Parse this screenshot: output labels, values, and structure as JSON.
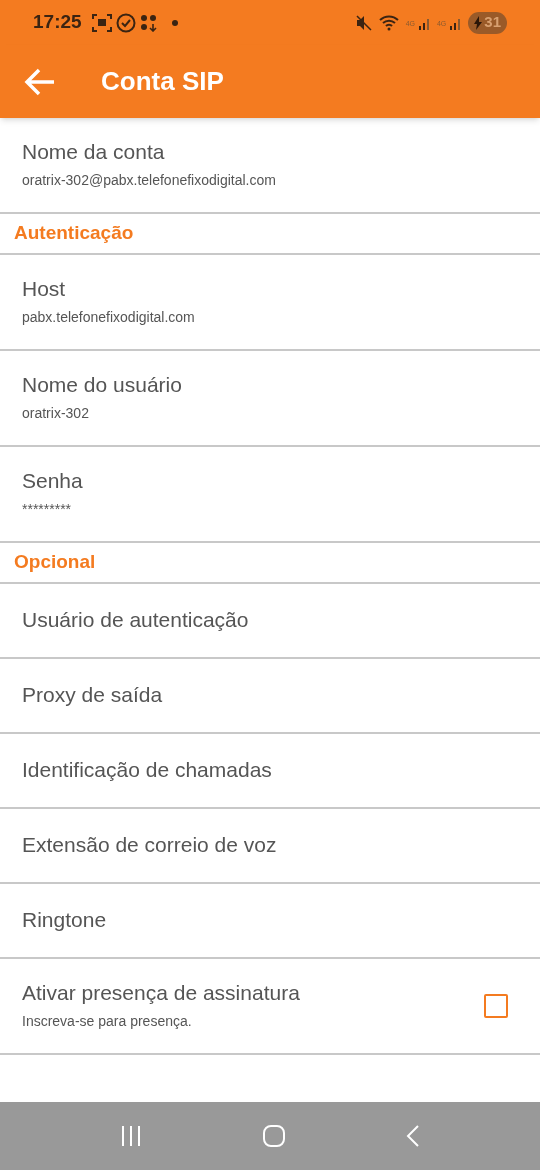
{
  "status_bar": {
    "time": "17:25",
    "network_labels": [
      "4G",
      "4G"
    ],
    "battery": "31"
  },
  "header": {
    "title": "Conta SIP"
  },
  "rows": [
    {
      "kind": "item",
      "title": "Nome da conta",
      "subtitle": "oratrix-302@pabx.telefonefixodigital.com"
    },
    {
      "kind": "section",
      "title": "Autenticação"
    },
    {
      "kind": "item",
      "title": "Host",
      "subtitle": "pabx.telefonefixodigital.com"
    },
    {
      "kind": "item",
      "title": "Nome do usuário",
      "subtitle": "oratrix-302"
    },
    {
      "kind": "item",
      "title": "Senha",
      "subtitle": "*********"
    },
    {
      "kind": "section",
      "title": "Opcional"
    },
    {
      "kind": "item",
      "title": "Usuário de autenticação"
    },
    {
      "kind": "item",
      "title": "Proxy de saída"
    },
    {
      "kind": "item",
      "title": "Identificação de chamadas"
    },
    {
      "kind": "item",
      "title": "Extensão de correio de voz"
    },
    {
      "kind": "item",
      "title": "Ringtone"
    },
    {
      "kind": "checkbox",
      "title": "Ativar presença de assinatura",
      "subtitle": "Inscreva-se para presença.",
      "checked": false
    }
  ]
}
